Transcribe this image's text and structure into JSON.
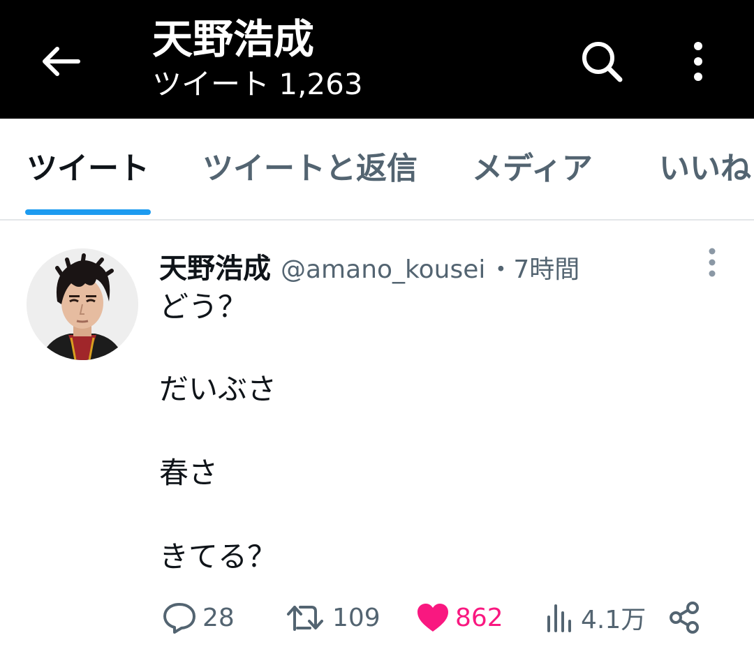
{
  "header": {
    "title": "天野浩成",
    "subtitle": "ツイート 1,263",
    "back_icon": "arrow-left-icon",
    "search_icon": "search-icon",
    "more_icon": "more-vertical-icon"
  },
  "tabs": [
    {
      "label": "ツイート",
      "active": true
    },
    {
      "label": "ツイートと返信",
      "active": false
    },
    {
      "label": "メディア",
      "active": false
    },
    {
      "label": "いいね",
      "active": false
    }
  ],
  "tweet": {
    "author_name": "天野浩成",
    "handle": "@amano_kousei",
    "time": "・7時間",
    "lines": [
      "どう？",
      "だいぶさ",
      "春さ",
      "きてる？"
    ],
    "actions": {
      "reply_count": "28",
      "retweet_count": "109",
      "like_count": "862",
      "views_count": "4.1万"
    }
  },
  "colors": {
    "accent": "#1d9bf0",
    "like": "#f91880",
    "secondary_text": "#536471",
    "header_bg": "#000000"
  }
}
